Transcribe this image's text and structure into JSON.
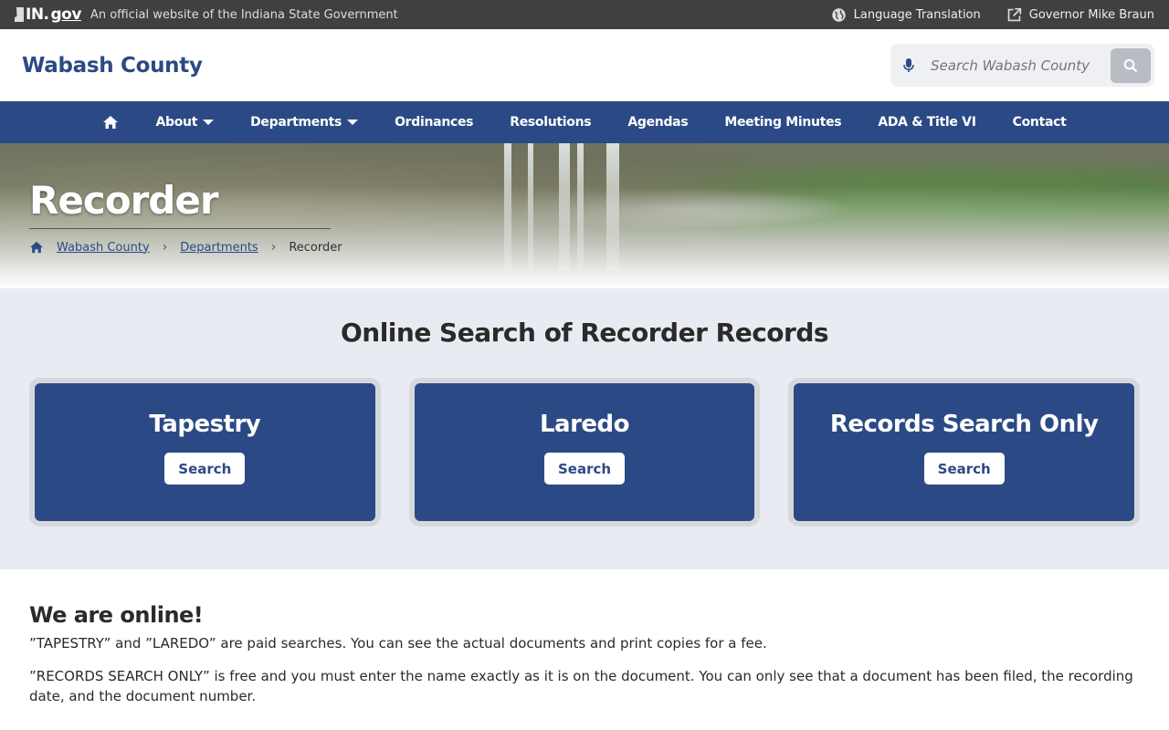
{
  "topbar": {
    "logo_text": "IN.",
    "logo_gov": "gov",
    "official_text": "An official website of the Indiana State Government",
    "language_label": "Language Translation",
    "governor_label": "Governor Mike Braun"
  },
  "header": {
    "site_title": "Wabash County",
    "search_placeholder": "Search Wabash County"
  },
  "nav": {
    "items": [
      {
        "label": "About"
      },
      {
        "label": "Departments"
      },
      {
        "label": "Ordinances"
      },
      {
        "label": "Resolutions"
      },
      {
        "label": "Agendas"
      },
      {
        "label": "Meeting Minutes"
      },
      {
        "label": "ADA & Title VI"
      },
      {
        "label": "Contact"
      }
    ]
  },
  "hero": {
    "title": "Recorder",
    "breadcrumb": [
      "Wabash County",
      "Departments",
      "Recorder"
    ]
  },
  "search_section": {
    "title": "Online Search of Recorder Records",
    "cards": [
      {
        "title": "Tapestry",
        "button": "Search"
      },
      {
        "title": "Laredo",
        "button": "Search"
      },
      {
        "title": "Records Search Only",
        "button": "Search"
      }
    ]
  },
  "info": {
    "heading": "We are online!",
    "paragraphs": [
      "”TAPESTRY” and ”LAREDO” are paid searches. You can see the actual documents and print copies for a fee.",
      "”RECORDS SEARCH ONLY” is free and you must enter the name exactly as it is on the document. You can only see that a document has been filed, the recording date, and the document number."
    ]
  },
  "colors": {
    "brand": "#2b4a85",
    "topbar": "#404040",
    "section_bg": "#e8ebf1"
  }
}
